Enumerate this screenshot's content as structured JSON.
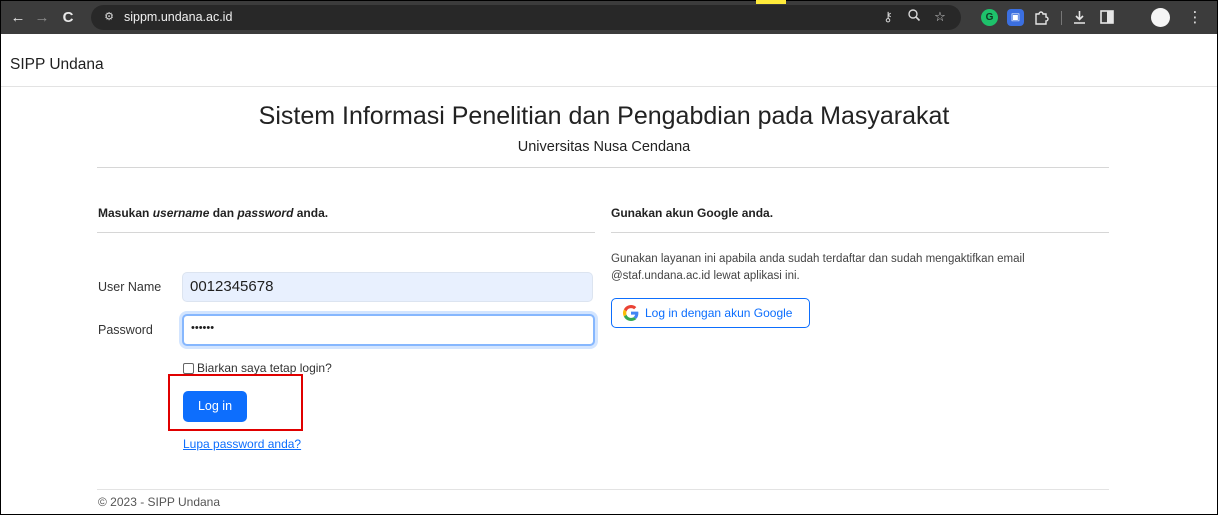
{
  "browser": {
    "url": "sippm.undana.ac.id",
    "icons": {
      "back": "back-arrow-icon",
      "forward": "forward-arrow-icon",
      "reload": "reload-icon",
      "site_settings": "site-settings-icon",
      "password_key": "key-icon",
      "zoom": "zoom-icon",
      "bookmark": "star-icon",
      "extensions": "puzzle-icon",
      "download": "download-icon",
      "sidepanel": "sidepanel-icon",
      "menu": "kebab-menu-icon"
    },
    "ext_grammarly_letter": "G"
  },
  "navbar": {
    "brand": "SIPP Undana"
  },
  "header": {
    "title": "Sistem Informasi Penelitian dan Pengabdian pada Masyarakat",
    "subtitle": "Universitas Nusa Cendana"
  },
  "login": {
    "heading_prefix": "Masukan ",
    "heading_username": "username",
    "heading_mid": " dan ",
    "heading_password": "password",
    "heading_suffix": " anda.",
    "username_label": "User Name",
    "username_value": "0012345678",
    "password_label": "Password",
    "password_value": "••••••",
    "remember_label": "Biarkan saya tetap login?",
    "submit_label": "Log in",
    "forgot_link": "Lupa password anda?"
  },
  "google": {
    "heading": "Gunakan akun Google anda.",
    "description": "Gunakan layanan ini apabila anda sudah terdaftar dan sudah mengaktifkan email @staf.undana.ac.id lewat aplikasi ini.",
    "button_label": "Log in dengan akun Google"
  },
  "footer": {
    "text": "© 2023 - SIPP Undana"
  },
  "colors": {
    "primary": "#0d6efd",
    "highlight_box": "#e00000",
    "chrome_bg": "#3c3c3c",
    "autofill_bg": "#e8f0fe"
  }
}
